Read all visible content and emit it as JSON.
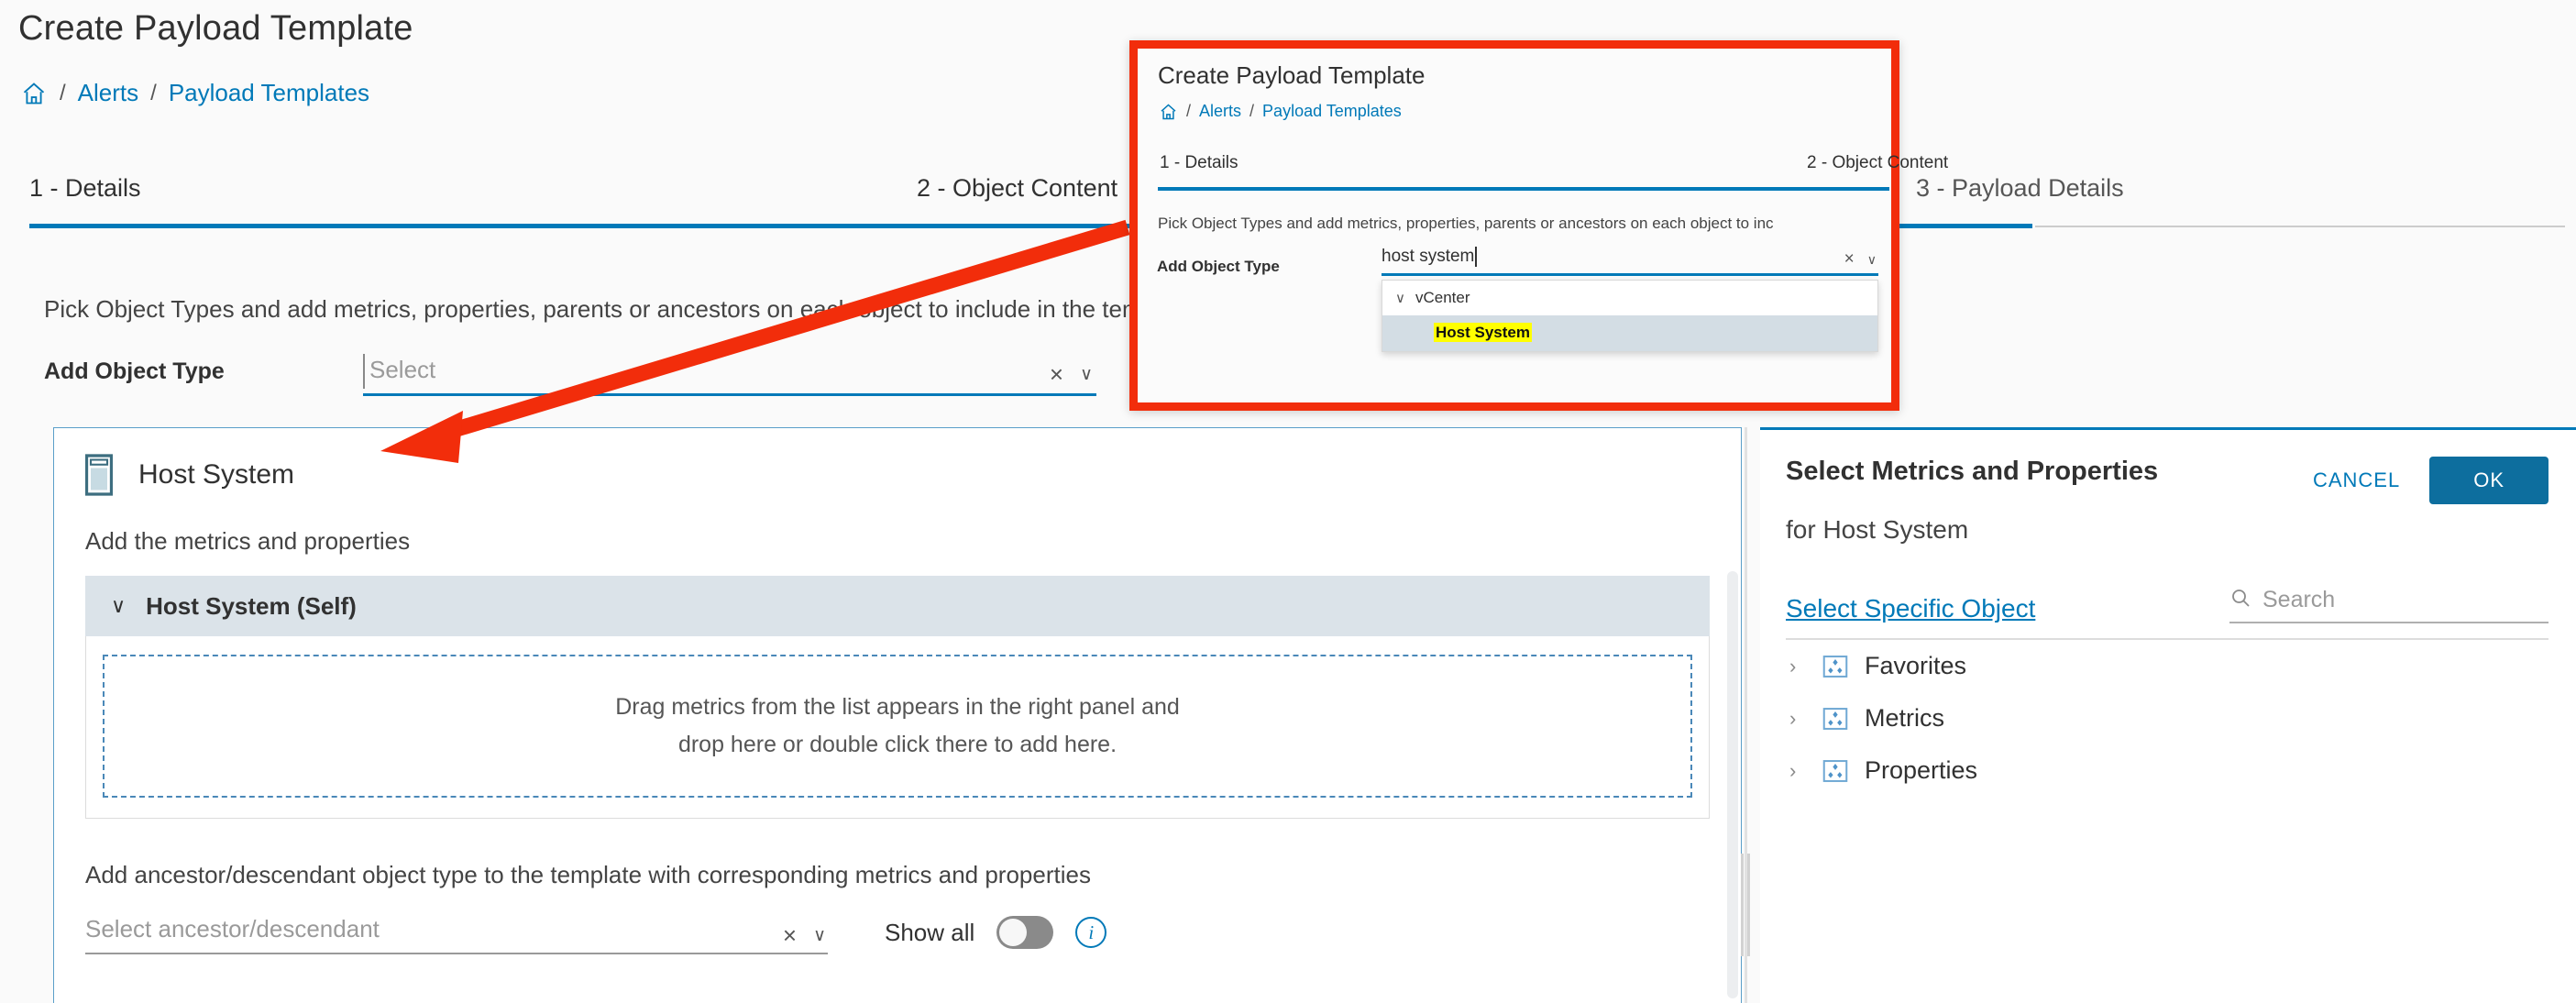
{
  "header": {
    "title": "Create Payload Template",
    "breadcrumb": {
      "home_icon": "home-icon",
      "separator": "/",
      "items": [
        {
          "label": "Alerts"
        },
        {
          "label": "Payload Templates"
        }
      ]
    }
  },
  "wizard": {
    "tabs": [
      {
        "label": "1 - Details",
        "active": true
      },
      {
        "label": "2 - Object Content",
        "active": true
      },
      {
        "label": "3 - Payload Details",
        "active": false
      }
    ]
  },
  "main": {
    "description": "Pick Object Types and add metrics, properties, parents or ancestors on each object to include in the template",
    "add_object_type": {
      "label": "Add Object Type",
      "placeholder": "Select",
      "value": "",
      "clear_icon": "×",
      "chevron_icon": "∨"
    },
    "card": {
      "object_icon": "host-system-icon",
      "object_title": "Host System",
      "add_metrics_label": "Add the metrics and properties",
      "self_section": {
        "chevron": "∨",
        "label": "Host System (Self)"
      },
      "dropzone": {
        "line1": "Drag metrics from the list appears in the right panel and",
        "line2": "drop here or double click there to add here."
      },
      "ancestor": {
        "label": "Add ancestor/descendant object type to the template with corresponding metrics and properties",
        "placeholder": "Select ancestor/descendant",
        "clear_icon": "×",
        "chevron_icon": "∨",
        "show_all_label": "Show all",
        "show_all_on": false,
        "info_icon": "i"
      }
    }
  },
  "right_panel": {
    "title": "Select Metrics and Properties",
    "subtitle": "for Host System",
    "cancel_label": "CANCEL",
    "ok_label": "OK",
    "select_specific_object": "Select Specific Object",
    "search_placeholder": "Search",
    "search_icon": "search-icon",
    "tree": [
      {
        "chevron": "›",
        "icon": "metrics-properties-icon",
        "label": "Favorites"
      },
      {
        "chevron": "›",
        "icon": "metrics-properties-icon",
        "label": "Metrics"
      },
      {
        "chevron": "›",
        "icon": "metrics-properties-icon",
        "label": "Properties"
      }
    ]
  },
  "callout": {
    "border_color": "#f22d0b",
    "title": "Create Payload Template",
    "breadcrumb": {
      "separator": "/",
      "items": [
        {
          "label": "Alerts"
        },
        {
          "label": "Payload Templates"
        }
      ]
    },
    "tabs": [
      {
        "label": "1 - Details"
      },
      {
        "label": "2 - Object Content"
      }
    ],
    "description": "Pick Object Types and add metrics, properties, parents or ancestors on each object to inc",
    "form_label": "Add Object Type",
    "input_value": "host system",
    "clear_icon": "×",
    "chevron_icon": "∨",
    "dropdown": {
      "group": {
        "chevron": "∨",
        "label": "vCenter"
      },
      "option": {
        "label": "Host System",
        "highlighted": true,
        "selected": true
      }
    }
  },
  "annotation": {
    "arrow_color": "#f22d0b",
    "type": "arrow-pointing-left-down"
  }
}
